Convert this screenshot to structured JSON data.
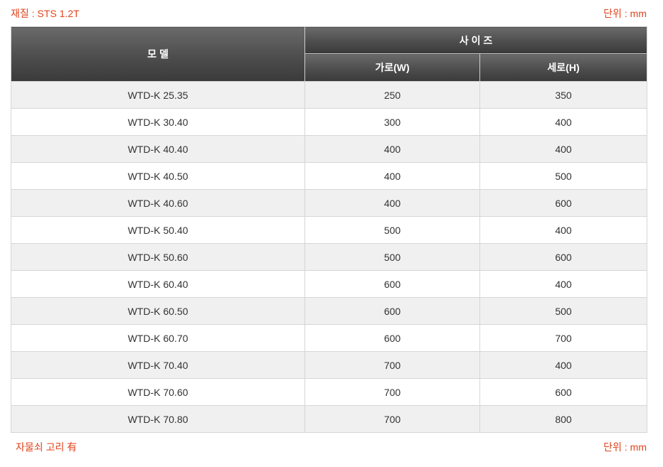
{
  "notes": {
    "material": "재질 : STS 1.2T",
    "unit": "단위 : mm",
    "extra": "자물쇠 고리 有"
  },
  "table": {
    "headers": {
      "model": "모 델",
      "size": "사 이 즈",
      "width": "가로(W)",
      "height": "세로(H)"
    },
    "rows": [
      {
        "model": "WTD-K 25.35",
        "width": "250",
        "height": "350"
      },
      {
        "model": "WTD-K 30.40",
        "width": "300",
        "height": "400"
      },
      {
        "model": "WTD-K 40.40",
        "width": "400",
        "height": "400"
      },
      {
        "model": "WTD-K 40.50",
        "width": "400",
        "height": "500"
      },
      {
        "model": "WTD-K 40.60",
        "width": "400",
        "height": "600"
      },
      {
        "model": "WTD-K 50.40",
        "width": "500",
        "height": "400"
      },
      {
        "model": "WTD-K 50.60",
        "width": "500",
        "height": "600"
      },
      {
        "model": "WTD-K 60.40",
        "width": "600",
        "height": "400"
      },
      {
        "model": "WTD-K 60.50",
        "width": "600",
        "height": "500"
      },
      {
        "model": "WTD-K 60.70",
        "width": "600",
        "height": "700"
      },
      {
        "model": "WTD-K 70.40",
        "width": "700",
        "height": "400"
      },
      {
        "model": "WTD-K 70.60",
        "width": "700",
        "height": "600"
      },
      {
        "model": "WTD-K 70.80",
        "width": "700",
        "height": "800"
      }
    ]
  },
  "colors": {
    "accent": "#e0431c",
    "header_bg": "#4d4d4d",
    "row_alt": "#f0f0f0"
  }
}
